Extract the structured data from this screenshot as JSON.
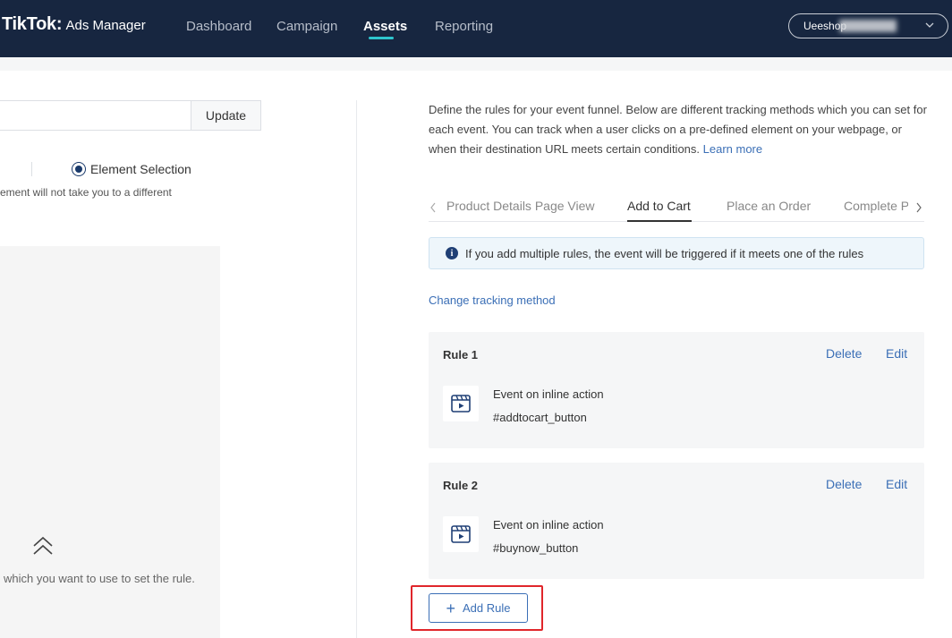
{
  "header": {
    "logo_main": "TikTok",
    "logo_colon": ":",
    "logo_sub": "Ads Manager",
    "nav": [
      {
        "label": "Dashboard",
        "active": false
      },
      {
        "label": "Campaign",
        "active": false
      },
      {
        "label": "Assets",
        "active": true
      },
      {
        "label": "Reporting",
        "active": false
      }
    ],
    "account_name": "Ueeshop"
  },
  "left_panel": {
    "update_label": "Update",
    "radio_label": "Element Selection",
    "hint": "ement will not take you to a different",
    "preview_caption": "which you want to use to set the rule."
  },
  "right_panel": {
    "intro": "Define the rules for your event funnel. Below are different tracking methods which you can set for each event. You can track when a user clicks on a pre-defined element on your webpage, or when their destination URL meets certain conditions.",
    "learn_more": "Learn more",
    "tabs": [
      {
        "label": "Product Details Page View",
        "active": false
      },
      {
        "label": "Add to Cart",
        "active": true
      },
      {
        "label": "Place an Order",
        "active": false
      },
      {
        "label": "Complete Payment",
        "active": false
      }
    ],
    "info": "If you add multiple rules, the event will be triggered if it meets one of the rules",
    "change_method": "Change tracking method",
    "rules": [
      {
        "title": "Rule 1",
        "delete": "Delete",
        "edit": "Edit",
        "event": "Event on inline action",
        "selector": "#addtocart_button"
      },
      {
        "title": "Rule 2",
        "delete": "Delete",
        "edit": "Edit",
        "event": "Event on inline action",
        "selector": "#buynow_button"
      }
    ],
    "add_rule": "Add Rule"
  },
  "colors": {
    "header_bg": "#172640",
    "accent_link": "#3b6fb6",
    "nav_underline": "#2ec5ce",
    "highlight": "#e0262b"
  },
  "icons": [
    "chevron-down-icon",
    "double-chevron-up-icon",
    "chevron-left-icon",
    "chevron-right-icon",
    "info-icon",
    "video-event-icon",
    "plus-icon"
  ]
}
